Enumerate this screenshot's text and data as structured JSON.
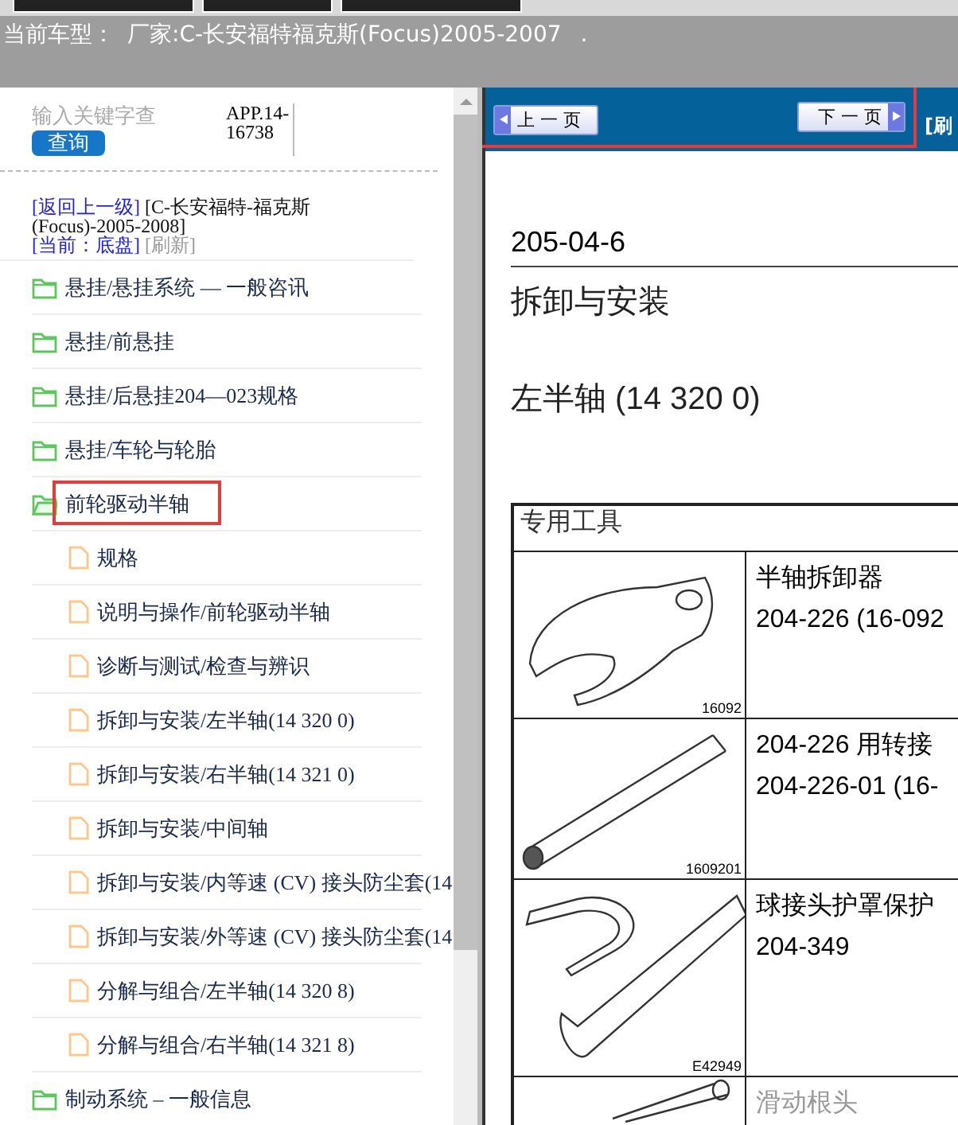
{
  "vehicle_bar": {
    "label": "当前车型：",
    "value": "厂家:C-长安福特福克斯(Focus)2005-2007",
    "mark": "."
  },
  "search": {
    "placeholder": "输入关键字查",
    "button": "查询",
    "code": "APP.14-16738"
  },
  "breadcrumb": {
    "back": "[返回上一级]",
    "path": "[C-长安福特-福克斯(Focus)-2005-2008]",
    "current": "[当前：底盘]",
    "refresh": "[刷新]"
  },
  "tree": [
    {
      "kind": "folder",
      "label": "悬挂/悬挂系统 — 一般咨讯",
      "expanded": false,
      "highlighted": false
    },
    {
      "kind": "folder",
      "label": "悬挂/前悬挂",
      "expanded": false,
      "highlighted": false
    },
    {
      "kind": "folder",
      "label": "悬挂/后悬挂204—023规格",
      "expanded": false,
      "highlighted": false
    },
    {
      "kind": "folder",
      "label": "悬挂/车轮与轮胎",
      "expanded": false,
      "highlighted": false
    },
    {
      "kind": "folder",
      "label": "前轮驱动半轴",
      "expanded": true,
      "highlighted": true,
      "children": [
        {
          "kind": "file",
          "label": "规格"
        },
        {
          "kind": "file",
          "label": "说明与操作/前轮驱动半轴"
        },
        {
          "kind": "file",
          "label": "诊断与测试/检查与辨识"
        },
        {
          "kind": "file",
          "label": "拆卸与安装/左半轴(14 320 0)"
        },
        {
          "kind": "file",
          "label": "拆卸与安装/右半轴(14 321 0)"
        },
        {
          "kind": "file",
          "label": "拆卸与安装/中间轴"
        },
        {
          "kind": "file",
          "label": "拆卸与安装/内等速 (CV) 接头防尘套(14"
        },
        {
          "kind": "file",
          "label": "拆卸与安装/外等速 (CV) 接头防尘套(14"
        },
        {
          "kind": "file",
          "label": "分解与组合/左半轴(14 320 8)"
        },
        {
          "kind": "file",
          "label": "分解与组合/右半轴(14 321 8)"
        }
      ]
    },
    {
      "kind": "folder",
      "label": "制动系统 – 一般信息",
      "expanded": false,
      "highlighted": false
    }
  ],
  "pager": {
    "prev": "上 一 页",
    "next": "下 一 页",
    "refresh": "[刷",
    "highlighted": true
  },
  "document": {
    "section": "205-04-6",
    "heading": "拆卸与安装",
    "title": "左半轴 (14 320 0)",
    "table": {
      "caption": "专用工具",
      "rows": [
        {
          "kind": "puller",
          "code": "16092",
          "lines": [
            "半轴拆卸器",
            "204-226 (16-092"
          ],
          "faded": false
        },
        {
          "kind": "rod",
          "code": "1609201",
          "lines": [
            "204-226 用转接",
            "204-226-01 (16-"
          ],
          "faded": false
        },
        {
          "kind": "hook",
          "code": "E42949",
          "lines": [
            "球接头护罩保护",
            "204-349"
          ],
          "faded": false
        },
        {
          "kind": "socket",
          "lines": [
            "滑动根头"
          ],
          "faded": true
        }
      ]
    }
  }
}
